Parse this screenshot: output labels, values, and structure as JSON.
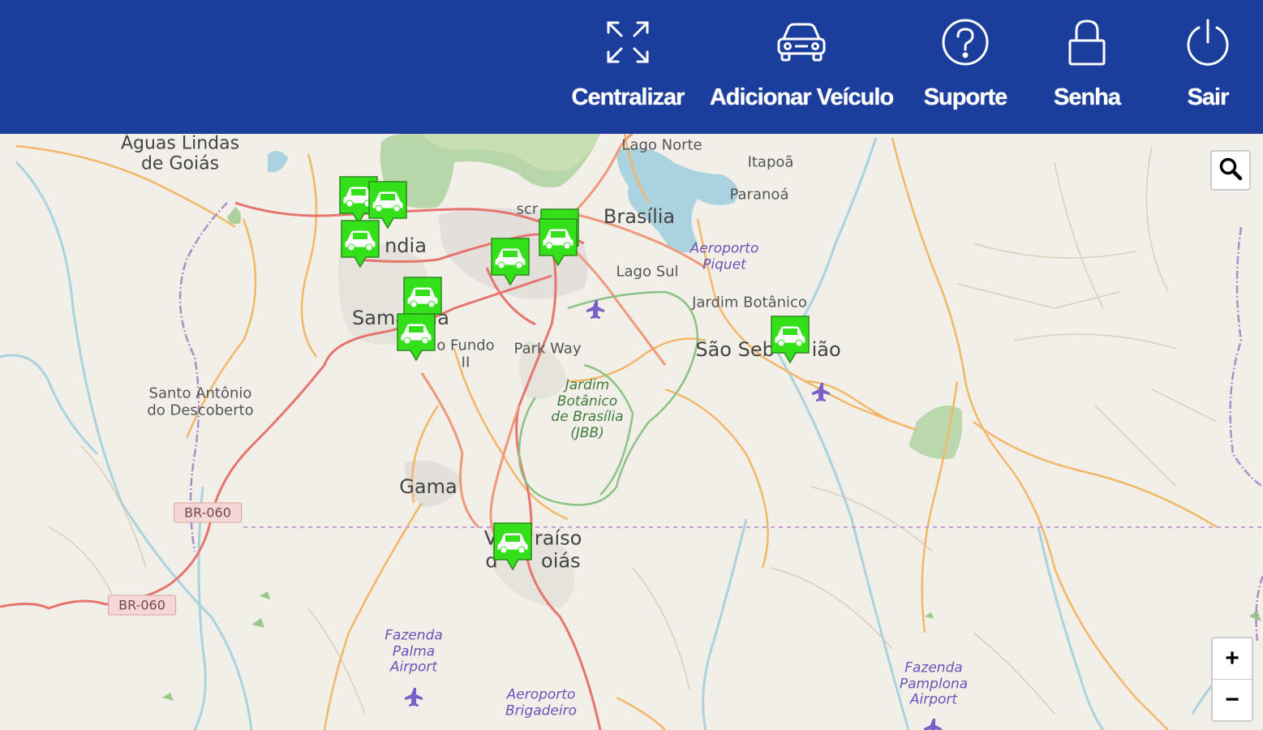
{
  "header": {
    "nav": [
      {
        "label": "Centralizar",
        "icon": "expand-arrows-icon"
      },
      {
        "label": "Adicionar Veículo",
        "icon": "car-icon"
      },
      {
        "label": "Suporte",
        "icon": "help-circle-icon"
      },
      {
        "label": "Senha",
        "icon": "lock-icon"
      },
      {
        "label": "Sair",
        "icon": "power-icon"
      }
    ]
  },
  "map": {
    "places": {
      "aguas_lindas": "Águas Lindas\nde Goiás",
      "lago_norte": "Lago Norte",
      "itapoa": "Itapoã",
      "paranoa": "Paranoá",
      "brasilia": "Brasília",
      "estrutural": "scr",
      "ceilandia": "ndia",
      "aeroporto_piquet": "Aeroporto\nPiquet",
      "lago_sul": "Lago Sul",
      "jardim_botanico": "Jardim Botânico",
      "samambaia": "Sama    ia",
      "recanto": "o Fundo\nII",
      "park_way": "Park Way",
      "sao_sebastiao": "São Seb      ião",
      "santo_antonio": "Santo Antônio\ndo Descoberto",
      "jardim_botanico_brasilia": "Jardim\nBotânico\nde Brasília\n(JBB)",
      "gama": "Gama",
      "valparaiso": "V      raíso\nd       oiás",
      "fazenda_palma": "Fazenda\nPalma\nAirport",
      "aeroporto_brigadeiro": "Aeroporto\nBrigadeiro",
      "fazenda_pamplona": "Fazenda\nPamplona\nAirport"
    },
    "shields": [
      "BR-060",
      "BR-060"
    ],
    "controls": {
      "zoom_in": "+",
      "zoom_out": "−"
    },
    "vehicle_marker_color": "#33e01a",
    "header_color": "#1b3d9c"
  }
}
